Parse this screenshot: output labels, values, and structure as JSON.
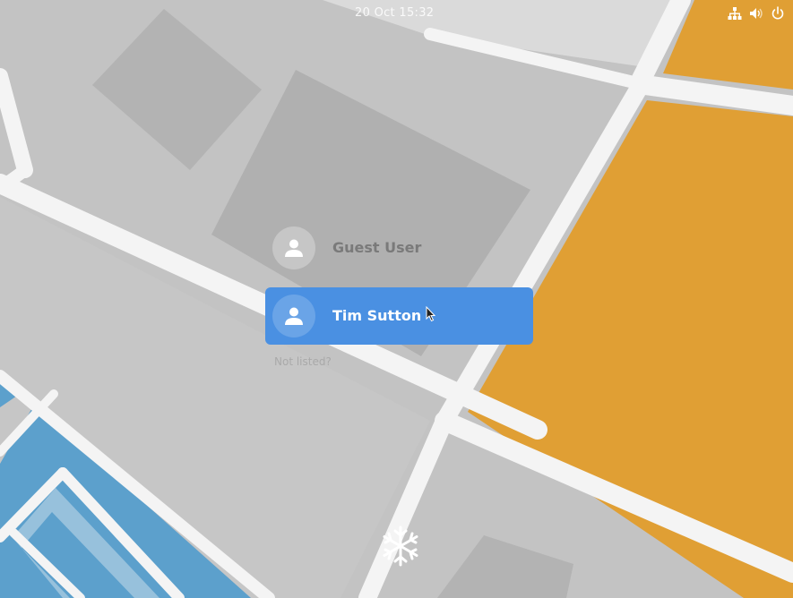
{
  "topbar": {
    "clock": "20 Oct 15:32",
    "icons": [
      "network-icon",
      "volume-icon",
      "power-icon"
    ]
  },
  "login": {
    "users": [
      {
        "name": "Guest User",
        "avatar_icon": "user-avatar-icon",
        "selected": false
      },
      {
        "name": "Tim Sutton",
        "avatar_icon": "user-avatar-icon",
        "selected": true
      }
    ],
    "not_listed": "Not listed?"
  },
  "footer": {
    "logo_icon": "snowflake-logo-icon"
  },
  "colors": {
    "selected_row": "#4a90e2",
    "map_gray": "#bfbfbf",
    "map_road": "#f2f2f2",
    "map_orange": "#e09f34",
    "map_blue": "#5ca0cc"
  }
}
